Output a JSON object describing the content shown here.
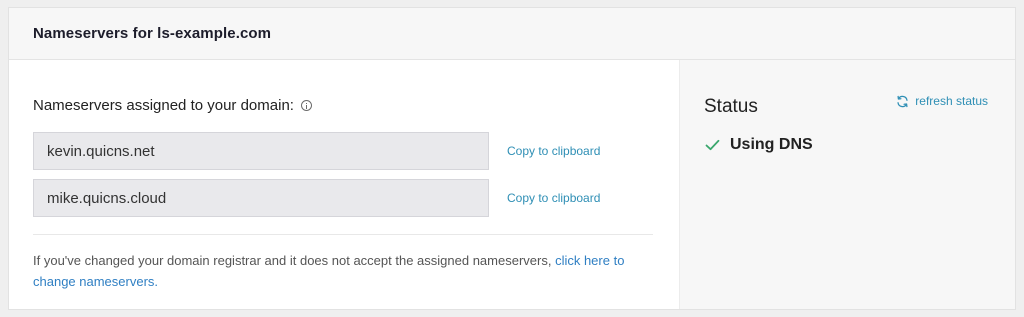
{
  "header": {
    "title": "Nameservers for ls-example.com"
  },
  "nameservers": {
    "heading": "Nameservers assigned to your domain:",
    "items": [
      {
        "value": "kevin.quicns.net",
        "copy_label": "Copy to clipboard"
      },
      {
        "value": "mike.quicns.cloud",
        "copy_label": "Copy to clipboard"
      }
    ],
    "footnote_text": "If you've changed your domain registrar and it does not accept the assigned nameservers, ",
    "footnote_link": "click here to change nameservers."
  },
  "status": {
    "title": "Status",
    "refresh_label": "refresh status",
    "value": "Using DNS"
  },
  "icons": {
    "info": "info-icon",
    "refresh": "refresh-icon",
    "check": "check-icon"
  },
  "colors": {
    "accent": "#2f8fb5",
    "link": "#2f7fc3",
    "check": "#3aa76d"
  }
}
